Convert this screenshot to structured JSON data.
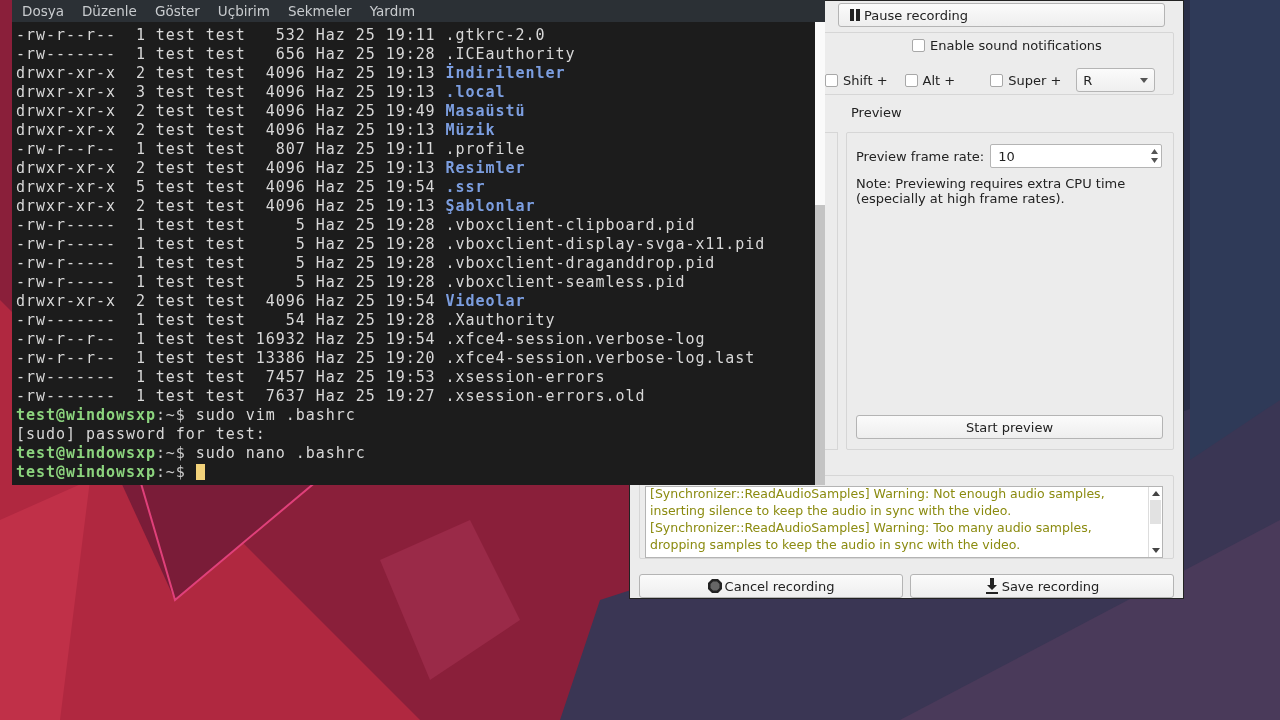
{
  "terminal": {
    "menu": [
      "Dosya",
      "Düzenle",
      "Göster",
      "Uçbirim",
      "Sekmeler",
      "Yardım"
    ],
    "lines": [
      {
        "kind": "entry",
        "text": "-rw-r--r--  1 test test   532 Haz 25 19:11 ",
        "name": ".gtkrc-2.0",
        "dir": false
      },
      {
        "kind": "entry",
        "text": "-rw-------  1 test test   656 Haz 25 19:28 ",
        "name": ".ICEauthority",
        "dir": false
      },
      {
        "kind": "entry",
        "text": "drwxr-xr-x  2 test test  4096 Haz 25 19:13 ",
        "name": "İndirilenler",
        "dir": true
      },
      {
        "kind": "entry",
        "text": "drwxr-xr-x  3 test test  4096 Haz 25 19:13 ",
        "name": ".local",
        "dir": true
      },
      {
        "kind": "entry",
        "text": "drwxr-xr-x  2 test test  4096 Haz 25 19:49 ",
        "name": "Masaüstü",
        "dir": true
      },
      {
        "kind": "entry",
        "text": "drwxr-xr-x  2 test test  4096 Haz 25 19:13 ",
        "name": "Müzik",
        "dir": true
      },
      {
        "kind": "entry",
        "text": "-rw-r--r--  1 test test   807 Haz 25 19:11 ",
        "name": ".profile",
        "dir": false
      },
      {
        "kind": "entry",
        "text": "drwxr-xr-x  2 test test  4096 Haz 25 19:13 ",
        "name": "Resimler",
        "dir": true
      },
      {
        "kind": "entry",
        "text": "drwxr-xr-x  5 test test  4096 Haz 25 19:54 ",
        "name": ".ssr",
        "dir": true
      },
      {
        "kind": "entry",
        "text": "drwxr-xr-x  2 test test  4096 Haz 25 19:13 ",
        "name": "Şablonlar",
        "dir": true
      },
      {
        "kind": "entry",
        "text": "-rw-r-----  1 test test     5 Haz 25 19:28 ",
        "name": ".vboxclient-clipboard.pid",
        "dir": false
      },
      {
        "kind": "entry",
        "text": "-rw-r-----  1 test test     5 Haz 25 19:28 ",
        "name": ".vboxclient-display-svga-x11.pid",
        "dir": false
      },
      {
        "kind": "entry",
        "text": "-rw-r-----  1 test test     5 Haz 25 19:28 ",
        "name": ".vboxclient-draganddrop.pid",
        "dir": false
      },
      {
        "kind": "entry",
        "text": "-rw-r-----  1 test test     5 Haz 25 19:28 ",
        "name": ".vboxclient-seamless.pid",
        "dir": false
      },
      {
        "kind": "entry",
        "text": "drwxr-xr-x  2 test test  4096 Haz 25 19:54 ",
        "name": "Videolar",
        "dir": true
      },
      {
        "kind": "entry",
        "text": "-rw-------  1 test test    54 Haz 25 19:28 ",
        "name": ".Xauthority",
        "dir": false
      },
      {
        "kind": "entry",
        "text": "-rw-r--r--  1 test test 16932 Haz 25 19:54 ",
        "name": ".xfce4-session.verbose-log",
        "dir": false
      },
      {
        "kind": "entry",
        "text": "-rw-r--r--  1 test test 13386 Haz 25 19:20 ",
        "name": ".xfce4-session.verbose-log.last",
        "dir": false
      },
      {
        "kind": "entry",
        "text": "-rw-------  1 test test  7457 Haz 25 19:53 ",
        "name": ".xsession-errors",
        "dir": false
      },
      {
        "kind": "entry",
        "text": "-rw-------  1 test test  7637 Haz 25 19:27 ",
        "name": ".xsession-errors.old",
        "dir": false
      },
      {
        "kind": "prompt",
        "user_host": "test@windowsxp",
        "path": ":~$",
        "command": "sudo vim .bashrc"
      },
      {
        "kind": "output",
        "text": "[sudo] password for test:"
      },
      {
        "kind": "prompt",
        "user_host": "test@windowsxp",
        "path": ":~$",
        "command": "sudo nano .bashrc"
      },
      {
        "kind": "prompt",
        "user_host": "test@windowsxp",
        "path": ":~$",
        "cursor": true
      }
    ]
  },
  "recorder": {
    "pause_button": "Pause recording",
    "sound_notifications": {
      "label": "Enable sound notifications",
      "checked": false
    },
    "hotkey": {
      "modifiers": [
        {
          "label": "Shift +",
          "checked": false
        },
        {
          "label": "Alt +",
          "checked": false
        },
        {
          "label": "Super +",
          "checked": false
        }
      ],
      "key": "R"
    },
    "preview": {
      "title": "Preview",
      "frame_rate_label": "Preview frame rate:",
      "frame_rate": "10",
      "note": "Note: Previewing requires extra CPU time (especially at high frame rates).",
      "start_button": "Start preview"
    },
    "log": [
      "[Synchronizer::ReadAudioSamples] Warning: Not enough audio samples, inserting silence to keep the audio in sync with the video.",
      "[Synchronizer::ReadAudioSamples] Warning: Too many audio samples, dropping samples to keep the audio in sync with the video."
    ],
    "cancel_button": "Cancel recording",
    "save_button": "Save recording"
  }
}
